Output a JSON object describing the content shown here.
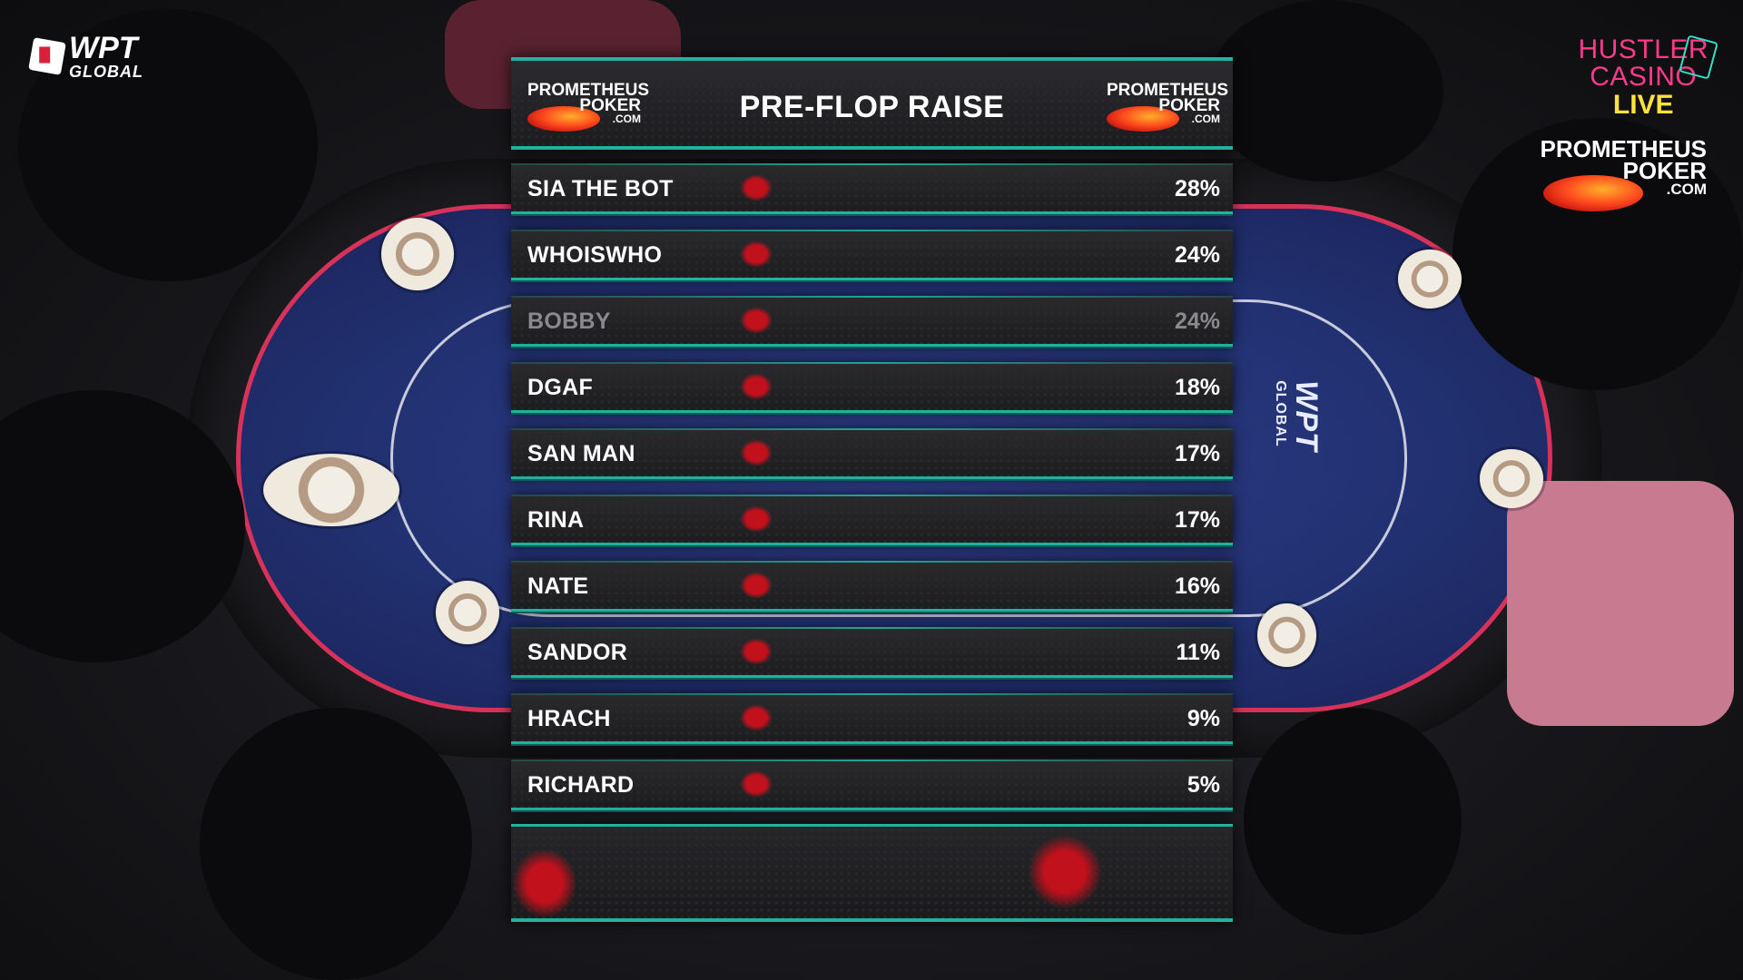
{
  "overlay": {
    "title": "PRE-FLOP RAISE",
    "rows": [
      {
        "name": "SIA THE BOT",
        "pct": "28%"
      },
      {
        "name": "WHOISWHO",
        "pct": "24%"
      },
      {
        "name": "BOBBY",
        "pct": "24%"
      },
      {
        "name": "DGAF",
        "pct": "18%"
      },
      {
        "name": "SAN MAN",
        "pct": "17%"
      },
      {
        "name": "RINA",
        "pct": "17%"
      },
      {
        "name": "NATE",
        "pct": "16%"
      },
      {
        "name": "SANDOR",
        "pct": "11%"
      },
      {
        "name": "HRACH",
        "pct": "9%"
      },
      {
        "name": "RICHARD",
        "pct": "5%"
      }
    ],
    "dimmed_row": "BOBBY"
  },
  "logos": {
    "wpt": {
      "line1": "WPT",
      "line2": "GLOBAL"
    },
    "hustler": {
      "line1": "HUSTLER",
      "line2": "CASINO",
      "line3": "LIVE"
    },
    "sponsor": {
      "line1": "PROMETHEUS",
      "line2": "POKER",
      "line3": ".COM"
    },
    "table_brand": {
      "line1": "WPT",
      "line2": "GLOBAL"
    }
  },
  "colors": {
    "accent_teal": "#1fb3a0",
    "splat_red": "#c0111c",
    "felt_blue": "#213070",
    "felt_border": "#d8325a"
  },
  "icons": [
    "wpt-diamond-icon",
    "playing-cards-icon",
    "flame-icon",
    "blood-splat-icon"
  ]
}
